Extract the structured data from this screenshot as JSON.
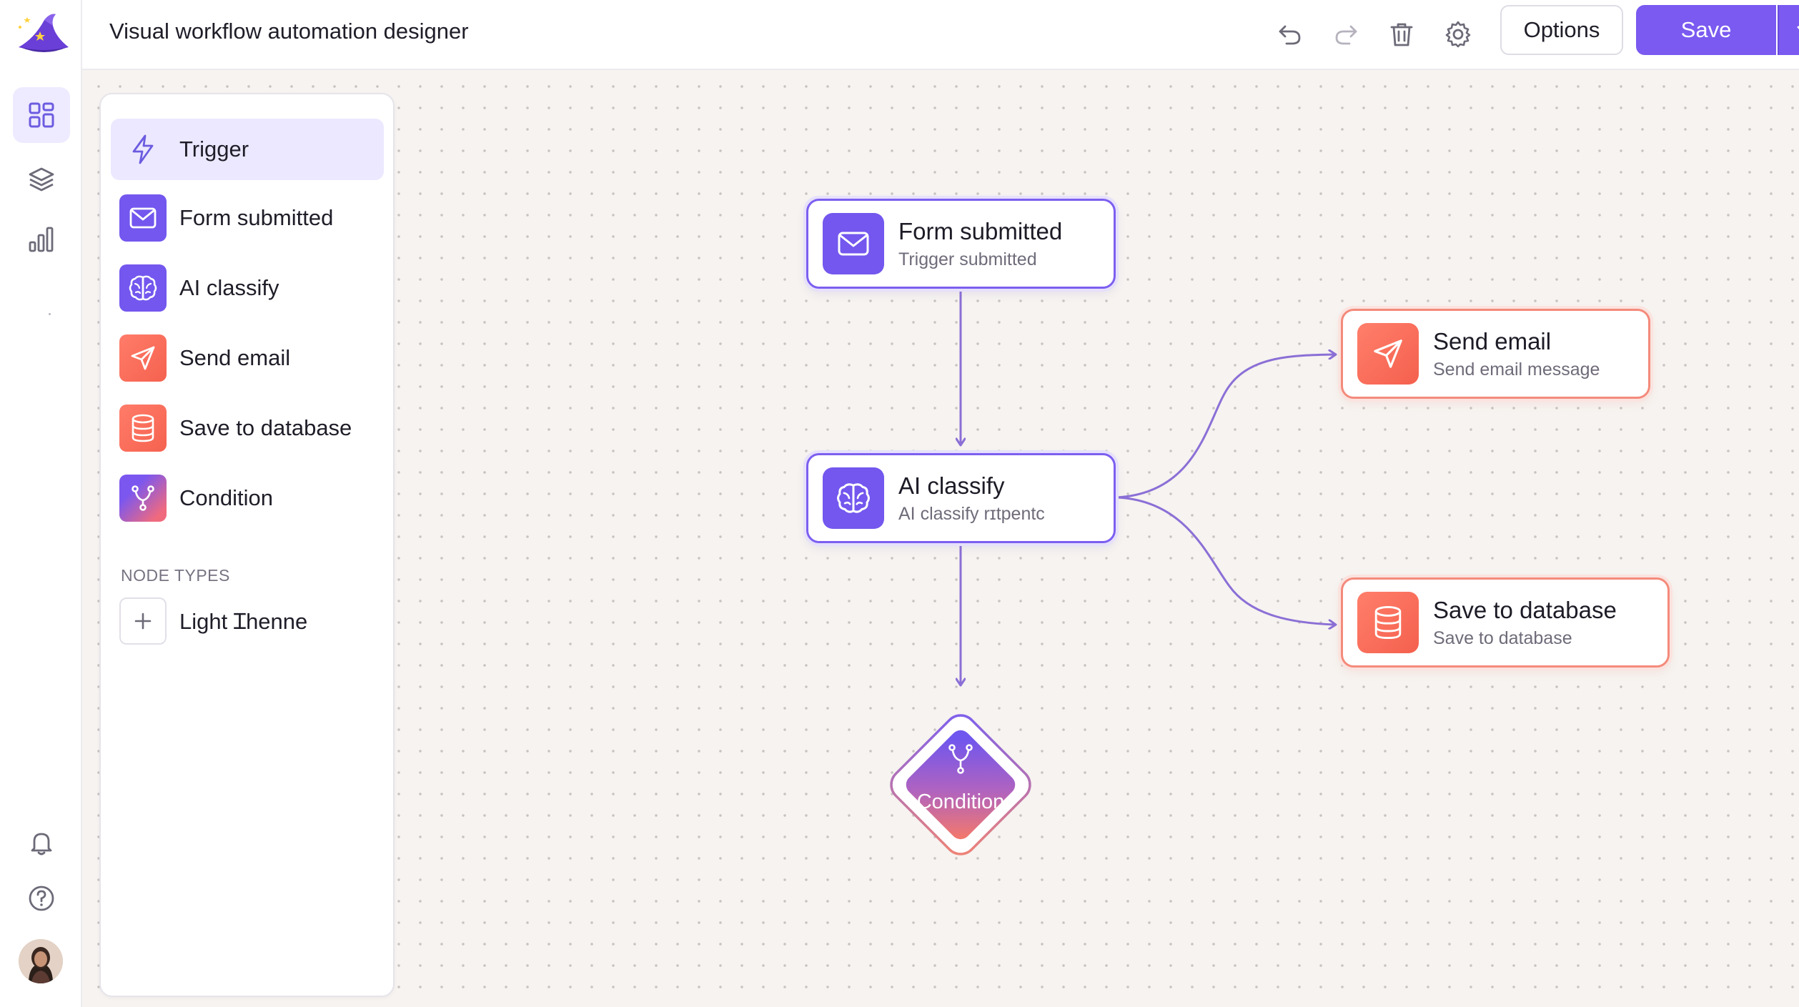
{
  "app": {
    "title": "Visual workflow automation designer"
  },
  "header": {
    "options_label": "Options",
    "save_label": "Save"
  },
  "palette": {
    "items": [
      {
        "label": "Trigger",
        "icon": "lightning-icon"
      },
      {
        "label": "Form submitted",
        "icon": "mail-icon"
      },
      {
        "label": "AI classify",
        "icon": "brain-icon"
      },
      {
        "label": "Send email",
        "icon": "send-icon"
      },
      {
        "label": "Save to database",
        "icon": "database-icon"
      },
      {
        "label": "Condition",
        "icon": "branch-icon"
      }
    ],
    "section_title": "NODE TYPES",
    "add_item_label": "Light Ɪhenne"
  },
  "canvas": {
    "nodes": {
      "form_submitted": {
        "title": "Form submitted",
        "subtitle": "Trigger submitted"
      },
      "ai_classify": {
        "title": "AI classify",
        "subtitle": "AI classify rɪtpentc"
      },
      "send_email": {
        "title": "Send email",
        "subtitle": "Send email message"
      },
      "save_db": {
        "title": "Save to database",
        "subtitle": "Save to database"
      },
      "condition": {
        "title": "Condition"
      }
    }
  },
  "colors": {
    "accent": "#7a5af0",
    "coral": "#f5624f",
    "canvas_bg": "#f6f3f0",
    "edge": "#8b6fd6"
  }
}
